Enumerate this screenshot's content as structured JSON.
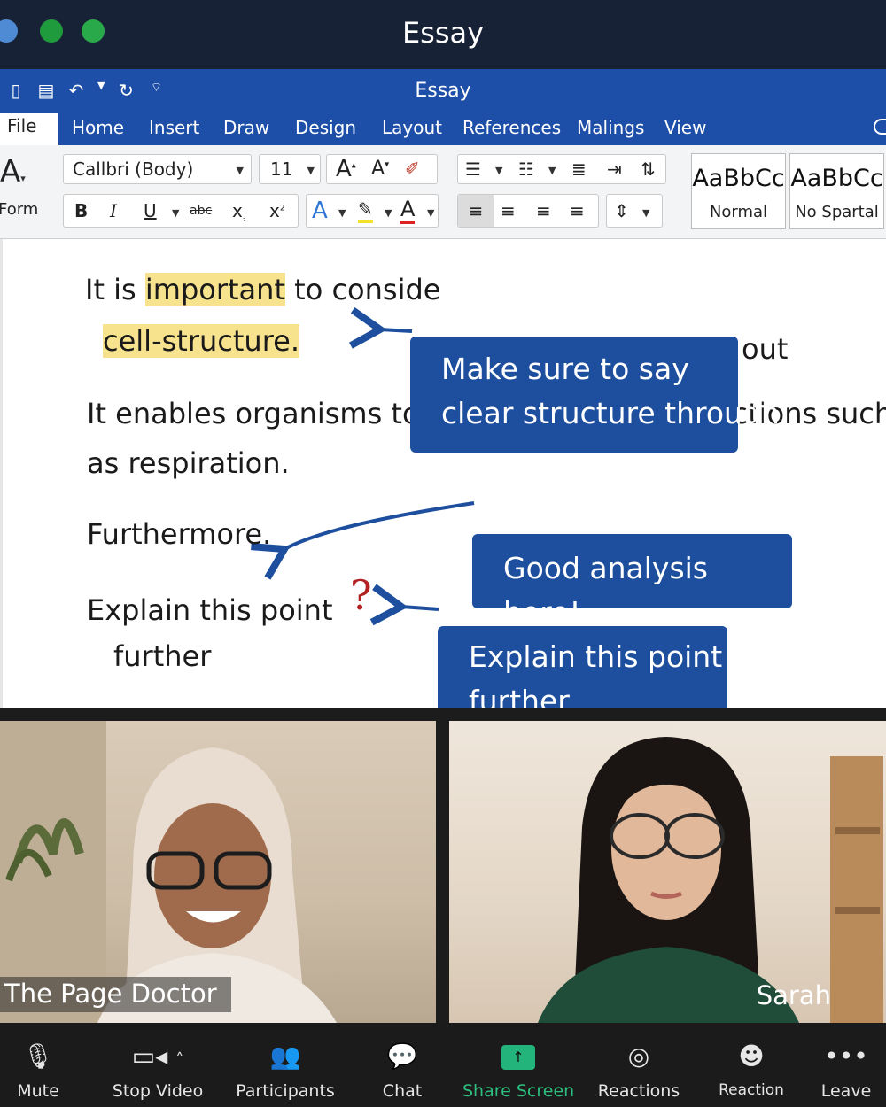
{
  "zoom": {
    "window_title": "Essay"
  },
  "word": {
    "title": "Essay",
    "tabs": [
      "File",
      "Home",
      "Insert",
      "Draw",
      "Design",
      "Layout",
      "References",
      "Malings",
      "View"
    ],
    "ribbon": {
      "font_family": "Callbri (Body)",
      "font_size": "11",
      "format_label": "Form",
      "styles": [
        {
          "sample": "AaBbCc",
          "name": "Normal"
        },
        {
          "sample": "AaBbCc",
          "name": "No Spartal"
        }
      ]
    },
    "document": {
      "line1_pre": "It is ",
      "line1_highlight": "important",
      "line1_post": " to conside",
      "line2_highlight": "cell-structure.",
      "line2_tail": "out",
      "para2_line1": "It enables organisms to perform essential functions such",
      "para2_line2": "as respiration.",
      "para3": "Furthermore.",
      "para4_line1": "Explain this point",
      "para4_line2": "further",
      "question_mark": "?"
    },
    "comments": [
      {
        "line1": "Make sure to say",
        "line2": "clear structure through"
      },
      {
        "line1": "Good analysis here!"
      },
      {
        "line1": "Explain this point",
        "line2": "further"
      }
    ]
  },
  "participants": [
    {
      "name": "The Page Doctor"
    },
    {
      "name": "Sarah"
    }
  ],
  "controls": [
    {
      "label": "Mute",
      "icon": "microphone-icon"
    },
    {
      "label": "Stop Video",
      "icon": "video-camera-icon"
    },
    {
      "label": "Participants",
      "icon": "participants-icon"
    },
    {
      "label": "Chat",
      "icon": "chat-bubble-icon"
    },
    {
      "label": "Share Screen",
      "icon": "share-screen-icon"
    },
    {
      "label": "Reactions",
      "icon": "reactions-icon"
    },
    {
      "label": "Reaction",
      "icon": "reaction-icon"
    },
    {
      "label": "Leave",
      "icon": "more-dots-icon"
    }
  ],
  "colors": {
    "accent": "#1e4fa8",
    "comment": "#1d4f9e",
    "share_green": "#2dbf7f",
    "highlight": "#f7e28d"
  }
}
